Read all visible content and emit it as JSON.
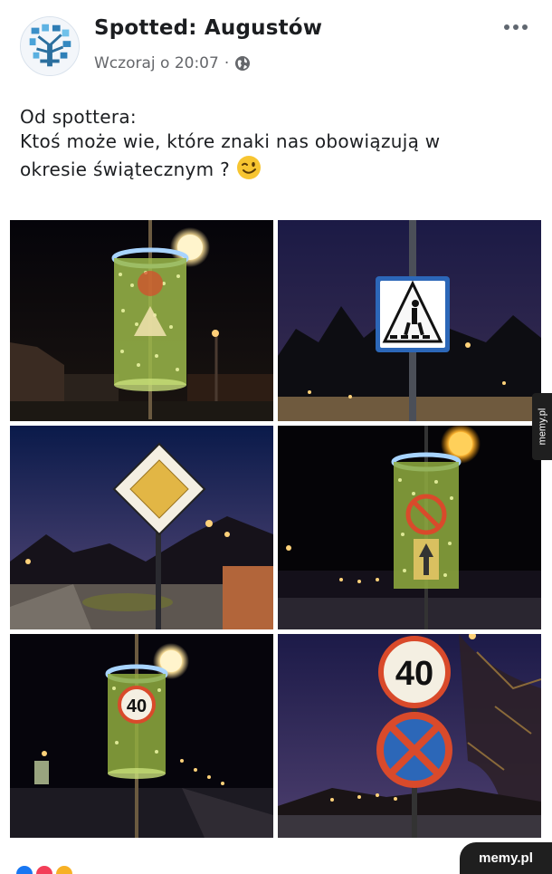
{
  "post": {
    "group_name": "Spotted: Augustów",
    "timestamp": "Wczoraj o 20:07",
    "separator": "·",
    "text_lines": [
      "Od spottera:",
      "Ktoś może wie, które znaki nas obowiązują w",
      "okresie świątecznym ?"
    ]
  },
  "icons": {
    "avatar": "group-avatar-tree",
    "audience": "globe-icon",
    "menu": "more-options-icon",
    "emoji": "winking-face-emoji"
  },
  "photos": [
    {
      "caption_signs": []
    },
    {
      "caption_signs": []
    },
    {
      "caption_signs": []
    },
    {
      "caption_signs": []
    },
    {
      "caption_signs": [
        "40"
      ]
    },
    {
      "caption_signs": [
        "40"
      ]
    }
  ],
  "watermarks": {
    "side": "memy.pl",
    "bottom": "memy.pl"
  },
  "colors": {
    "reaction_like": "#1877f2",
    "reaction_love": "#f33e58",
    "reaction_haha": "#f7b125"
  }
}
